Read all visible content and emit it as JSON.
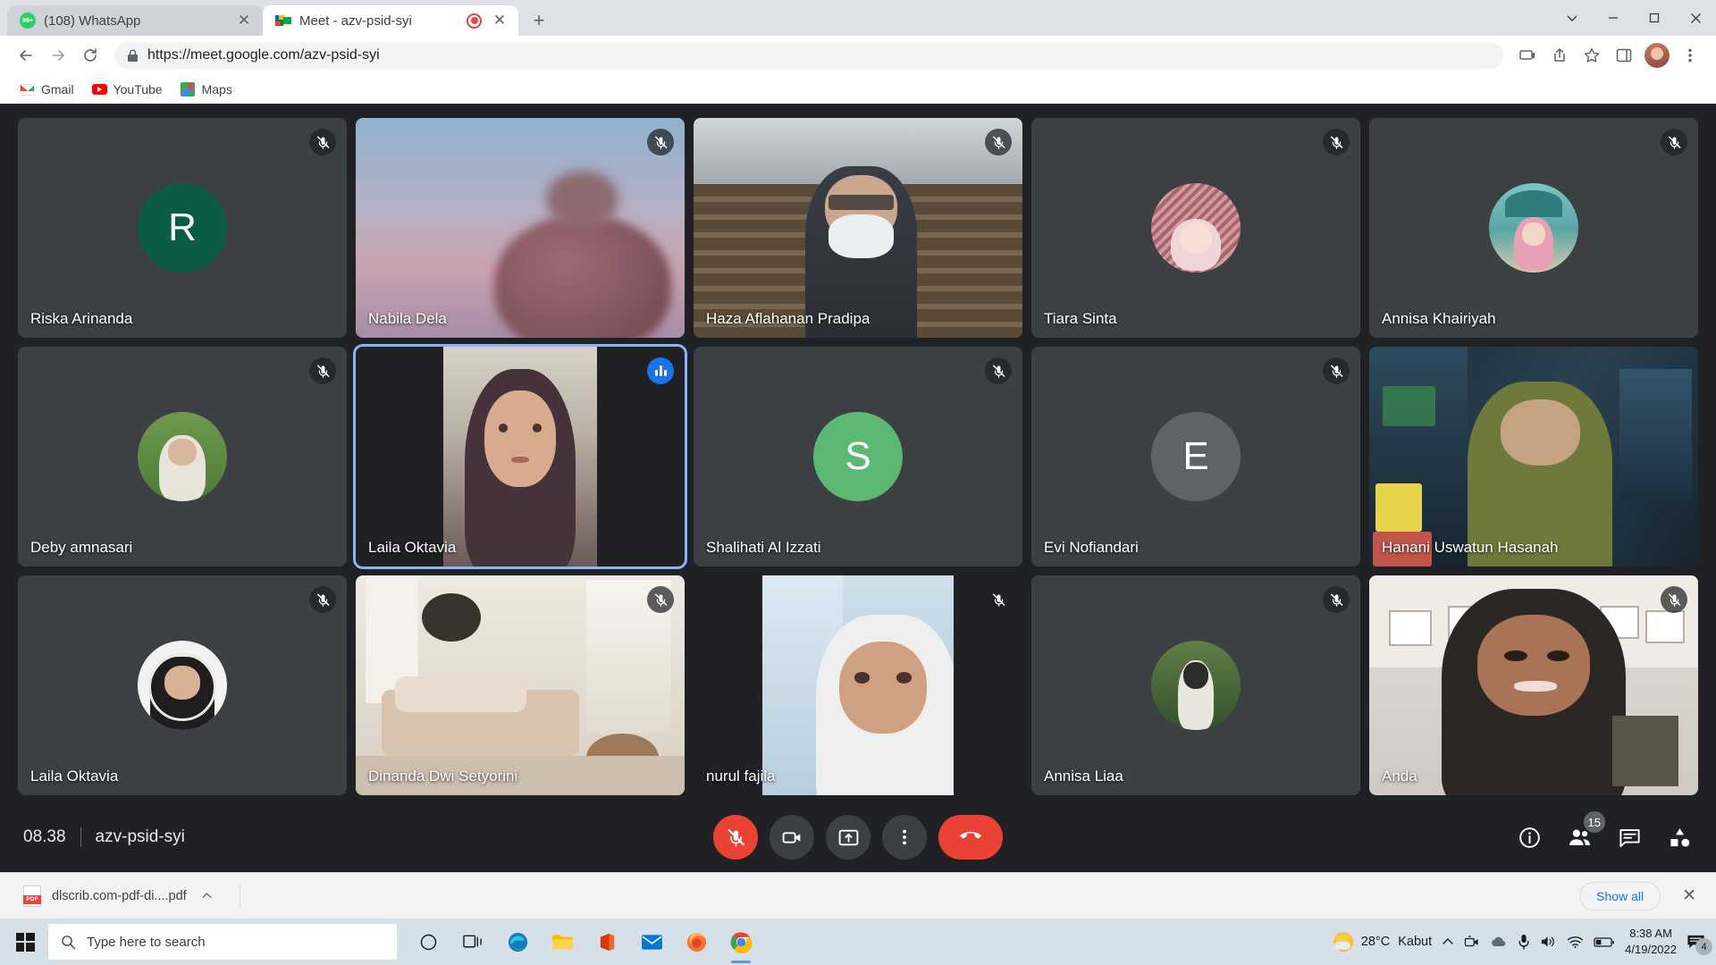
{
  "browser": {
    "tabs": [
      {
        "title": "(108) WhatsApp",
        "favicon": "whatsapp-icon",
        "active": false,
        "recording": false
      },
      {
        "title": "Meet - azv-psid-syi",
        "favicon": "google-meet-icon",
        "active": true,
        "recording": true
      }
    ],
    "new_tab_label": "+",
    "close_label": "✕",
    "window_controls": {
      "expand": "⌄",
      "minimize": "─",
      "maximize": "□",
      "close": "✕"
    },
    "toolbar": {
      "back_icon": "back-arrow-icon",
      "forward_icon": "forward-arrow-icon",
      "reload_icon": "reload-icon",
      "lock_icon": "lock-icon",
      "url_protocol": "https://",
      "url_host": "meet.google.com",
      "url_path": "/azv-psid-syi",
      "url_full": "https://meet.google.com/azv-psid-syi"
    },
    "bookmarks": [
      {
        "label": "Gmail",
        "icon": "gmail-icon"
      },
      {
        "label": "YouTube",
        "icon": "youtube-icon"
      },
      {
        "label": "Maps",
        "icon": "google-maps-icon"
      }
    ]
  },
  "meet": {
    "meeting_time": "08.38",
    "meeting_code": "azv-psid-syi",
    "participant_count": "15",
    "participants": [
      {
        "name": "Riska Arinanda",
        "kind": "initial",
        "initial": "R",
        "color": "#0b5c47",
        "muted": true,
        "speaking": false
      },
      {
        "name": "Nabila Dela",
        "kind": "video",
        "video": "sunset-portrait",
        "muted": true,
        "speaking": false
      },
      {
        "name": "Haza Aflahanan Pradipa",
        "kind": "video",
        "video": "bookshelf-room",
        "muted": true,
        "speaking": false
      },
      {
        "name": "Tiara Sinta",
        "kind": "photo",
        "photo": "pink-portrait",
        "muted": true,
        "speaking": false
      },
      {
        "name": "Annisa Khairiyah",
        "kind": "photo",
        "photo": "teal-mosque",
        "muted": true,
        "speaking": false
      },
      {
        "name": "Deby amnasari",
        "kind": "photo",
        "photo": "green-garden",
        "muted": true,
        "speaking": false
      },
      {
        "name": "Laila Oktavia",
        "kind": "video",
        "video": "portrait-woman",
        "muted": false,
        "speaking": true,
        "active_speaker": true
      },
      {
        "name": "Shalihati Al Izzati",
        "kind": "initial",
        "initial": "S",
        "color": "#5bb974",
        "muted": true,
        "speaking": false
      },
      {
        "name": "Evi Nofiandari",
        "kind": "initial",
        "initial": "E",
        "color": "#5f6368",
        "muted": true,
        "speaking": false
      },
      {
        "name": "Hanani Uswatun Hasanah",
        "kind": "video",
        "video": "car-interior",
        "muted": false,
        "speaking": false
      },
      {
        "name": "Laila Oktavia",
        "kind": "photo",
        "photo": "white-circle-hijab",
        "muted": true,
        "speaking": false
      },
      {
        "name": "Dinanda Dwi Setyorini",
        "kind": "video",
        "video": "beige-living-room",
        "muted": true,
        "speaking": false
      },
      {
        "name": "nurul fajila",
        "kind": "video",
        "video": "window-portrait",
        "muted": true,
        "speaking": false
      },
      {
        "name": "Annisa Liaa",
        "kind": "photo",
        "photo": "dark-garden",
        "muted": true,
        "speaking": false
      },
      {
        "name": "Anda",
        "kind": "video",
        "video": "cafe-selfie",
        "muted": true,
        "speaking": false
      }
    ],
    "controls": [
      {
        "name": "microphone-off-button",
        "icon": "mic-off-icon",
        "state": "muted"
      },
      {
        "name": "camera-button",
        "icon": "video-camera-icon",
        "state": "on"
      },
      {
        "name": "present-screen-button",
        "icon": "present-screen-icon",
        "state": "default"
      },
      {
        "name": "more-options-button",
        "icon": "more-vertical-icon",
        "state": "default"
      },
      {
        "name": "leave-call-button",
        "icon": "hangup-phone-icon",
        "state": "danger"
      }
    ],
    "right_controls": [
      {
        "name": "meeting-details-button",
        "icon": "info-icon",
        "badge": null
      },
      {
        "name": "show-everyone-button",
        "icon": "people-icon",
        "badge": "15"
      },
      {
        "name": "chat-button",
        "icon": "chat-icon",
        "badge": null
      },
      {
        "name": "activities-button",
        "icon": "activities-icon",
        "badge": null
      }
    ]
  },
  "download_shelf": {
    "file_name": "dlscrib.com-pdf-di....pdf",
    "file_type_badge": "PDF",
    "caret": "ⱏ",
    "show_all_label": "Show all",
    "close_label": "✕"
  },
  "taskbar": {
    "start_label": "windows-logo",
    "search_placeholder": "Type here to search",
    "apps": [
      {
        "name": "cortana-icon"
      },
      {
        "name": "task-view-icon"
      },
      {
        "name": "microsoft-edge-icon"
      },
      {
        "name": "file-explorer-icon"
      },
      {
        "name": "microsoft-office-icon"
      },
      {
        "name": "mail-icon"
      },
      {
        "name": "firefox-icon"
      },
      {
        "name": "google-chrome-icon",
        "running": true
      }
    ],
    "weather_temp": "28°C",
    "weather_desc": "Kabut",
    "time": "8:38 AM",
    "date": "4/19/2022",
    "notification_count": "4"
  },
  "colors": {
    "meet_bg": "#202124",
    "tile_bg": "#3c4043",
    "accent_blue": "#8ab4f8",
    "danger_red": "#ea4335",
    "speaking_blue": "#1a73e8"
  }
}
